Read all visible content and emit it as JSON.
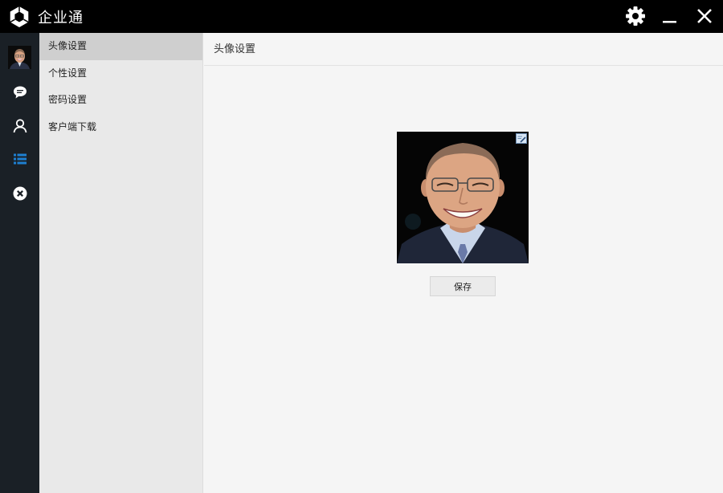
{
  "app": {
    "title": "企业通"
  },
  "menu": {
    "items": [
      {
        "label": "头像设置",
        "active": true
      },
      {
        "label": "个性设置",
        "active": false
      },
      {
        "label": "密码设置",
        "active": false
      },
      {
        "label": "客户端下载",
        "active": false
      }
    ]
  },
  "content": {
    "title": "头像设置",
    "save_label": "保存"
  },
  "icons": {
    "titlebar": [
      "app-logo-icon",
      "gear-icon",
      "minimize-icon",
      "close-icon"
    ],
    "rail": [
      "avatar",
      "chat-bubble-icon",
      "contact-icon",
      "list-icon",
      "close-circle-icon"
    ]
  },
  "colors": {
    "titlebar_bg": "#000000",
    "rail_bg": "#1a2026",
    "rail_active": "#1e7fd0",
    "menu_bg": "#e9e9e9",
    "menu_active": "#cfcfcf",
    "content_bg": "#f5f5f5"
  }
}
